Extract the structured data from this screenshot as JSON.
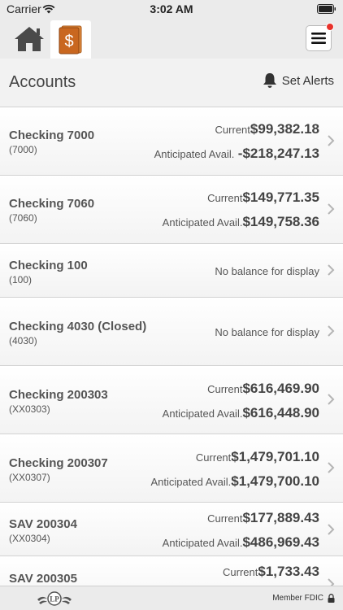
{
  "status_bar": {
    "carrier": "Carrier",
    "time": "3:02 AM"
  },
  "header": {
    "title": "Accounts",
    "set_alerts_label": "Set Alerts"
  },
  "accounts": [
    {
      "name": "Checking 7000",
      "number": "(7000)",
      "current_label": "Current",
      "current": "$99,382.18",
      "anticipated_label": "Anticipated Avail.",
      "anticipated": "-$218,247.13"
    },
    {
      "name": "Checking 7060",
      "number": "(7060)",
      "current_label": "Current",
      "current": "$149,771.35",
      "anticipated_label": "Anticipated Avail.",
      "anticipated": "$149,758.36"
    },
    {
      "name": "Checking 100",
      "number": "(100)",
      "no_balance": "No balance for display"
    },
    {
      "name": "Checking 4030 (Closed)",
      "number": "(4030)",
      "no_balance": "No balance for display"
    },
    {
      "name": "Checking 200303",
      "number": "(XX0303)",
      "current_label": "Current",
      "current": "$616,469.90",
      "anticipated_label": "Anticipated Avail.",
      "anticipated": "$616,448.90"
    },
    {
      "name": "Checking 200307",
      "number": "(XX0307)",
      "current_label": "Current",
      "current": "$1,479,701.10",
      "anticipated_label": "Anticipated Avail.",
      "anticipated": "$1,479,700.10"
    },
    {
      "name": "SAV 200304",
      "number": "(XX0304)",
      "current_label": "Current",
      "current": "$177,889.43",
      "anticipated_label": "Anticipated Avail.",
      "anticipated": "$486,969.43"
    },
    {
      "name": "SAV 200305",
      "current_label": "Current",
      "current": "$1,733.43"
    }
  ],
  "footer": {
    "logo_text": "LP",
    "member_fdic": "Member FDIC"
  },
  "colors": {
    "brand_orange": "#d2691e",
    "alert_dot": "#e8322b",
    "nav_bg": "#ebebeb"
  }
}
